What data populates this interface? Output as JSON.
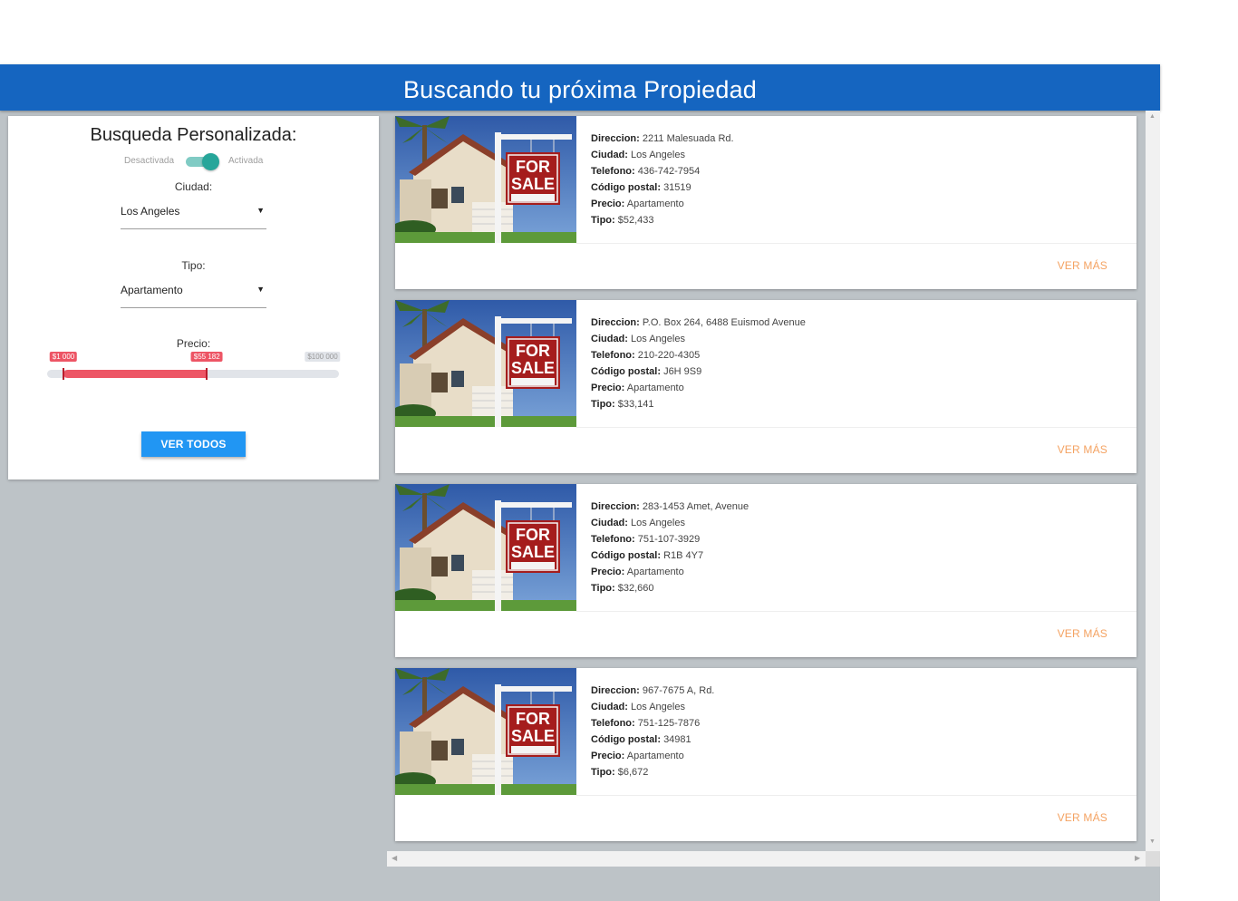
{
  "header": {
    "title": "Buscando tu próxima Propiedad"
  },
  "filters": {
    "title": "Busqueda Personalizada:",
    "switch": {
      "off_label": "Desactivada",
      "on_label": "Activada",
      "state": "on"
    },
    "city": {
      "label": "Ciudad:",
      "selected": "Los Angeles"
    },
    "type": {
      "label": "Tipo:",
      "selected": "Apartamento"
    },
    "price": {
      "label": "Precio:",
      "min_label": "$1 000",
      "current_label": "$55 182",
      "max_label": "$100 000",
      "min": 1000,
      "max": 100000,
      "from": 1000,
      "to": 55182
    },
    "see_all_label": "VER TODOS",
    "colors": {
      "switch": "#26a69a",
      "slider": "#ed5565",
      "button": "#2196f3"
    }
  },
  "listings": [
    {
      "direccion_label": "Direccion:",
      "direccion": "2211 Malesuada Rd.",
      "ciudad_label": "Ciudad:",
      "ciudad": "Los Angeles",
      "telefono_label": "Telefono:",
      "telefono": "436-742-7954",
      "postal_label": "Código postal:",
      "postal": "31519",
      "precio_label": "Precio:",
      "precio": "Apartamento",
      "tipo_label": "Tipo:",
      "tipo": "$52,433",
      "more_label": "VER MÁS",
      "image": "for-sale-house-photo"
    },
    {
      "direccion_label": "Direccion:",
      "direccion": "P.O. Box 264, 6488 Euismod Avenue",
      "ciudad_label": "Ciudad:",
      "ciudad": "Los Angeles",
      "telefono_label": "Telefono:",
      "telefono": "210-220-4305",
      "postal_label": "Código postal:",
      "postal": "J6H 9S9",
      "precio_label": "Precio:",
      "precio": "Apartamento",
      "tipo_label": "Tipo:",
      "tipo": "$33,141",
      "more_label": "VER MÁS",
      "image": "for-sale-house-photo"
    },
    {
      "direccion_label": "Direccion:",
      "direccion": "283-1453 Amet, Avenue",
      "ciudad_label": "Ciudad:",
      "ciudad": "Los Angeles",
      "telefono_label": "Telefono:",
      "telefono": "751-107-3929",
      "postal_label": "Código postal:",
      "postal": "R1B 4Y7",
      "precio_label": "Precio:",
      "precio": "Apartamento",
      "tipo_label": "Tipo:",
      "tipo": "$32,660",
      "more_label": "VER MÁS",
      "image": "for-sale-house-photo"
    },
    {
      "direccion_label": "Direccion:",
      "direccion": "967-7675 A, Rd.",
      "ciudad_label": "Ciudad:",
      "ciudad": "Los Angeles",
      "telefono_label": "Telefono:",
      "telefono": "751-125-7876",
      "postal_label": "Código postal:",
      "postal": "34981",
      "precio_label": "Precio:",
      "precio": "Apartamento",
      "tipo_label": "Tipo:",
      "tipo": "$6,672",
      "more_label": "VER MÁS",
      "image": "for-sale-house-photo"
    }
  ],
  "sign_text": {
    "line1": "FOR",
    "line2": "SALE"
  }
}
